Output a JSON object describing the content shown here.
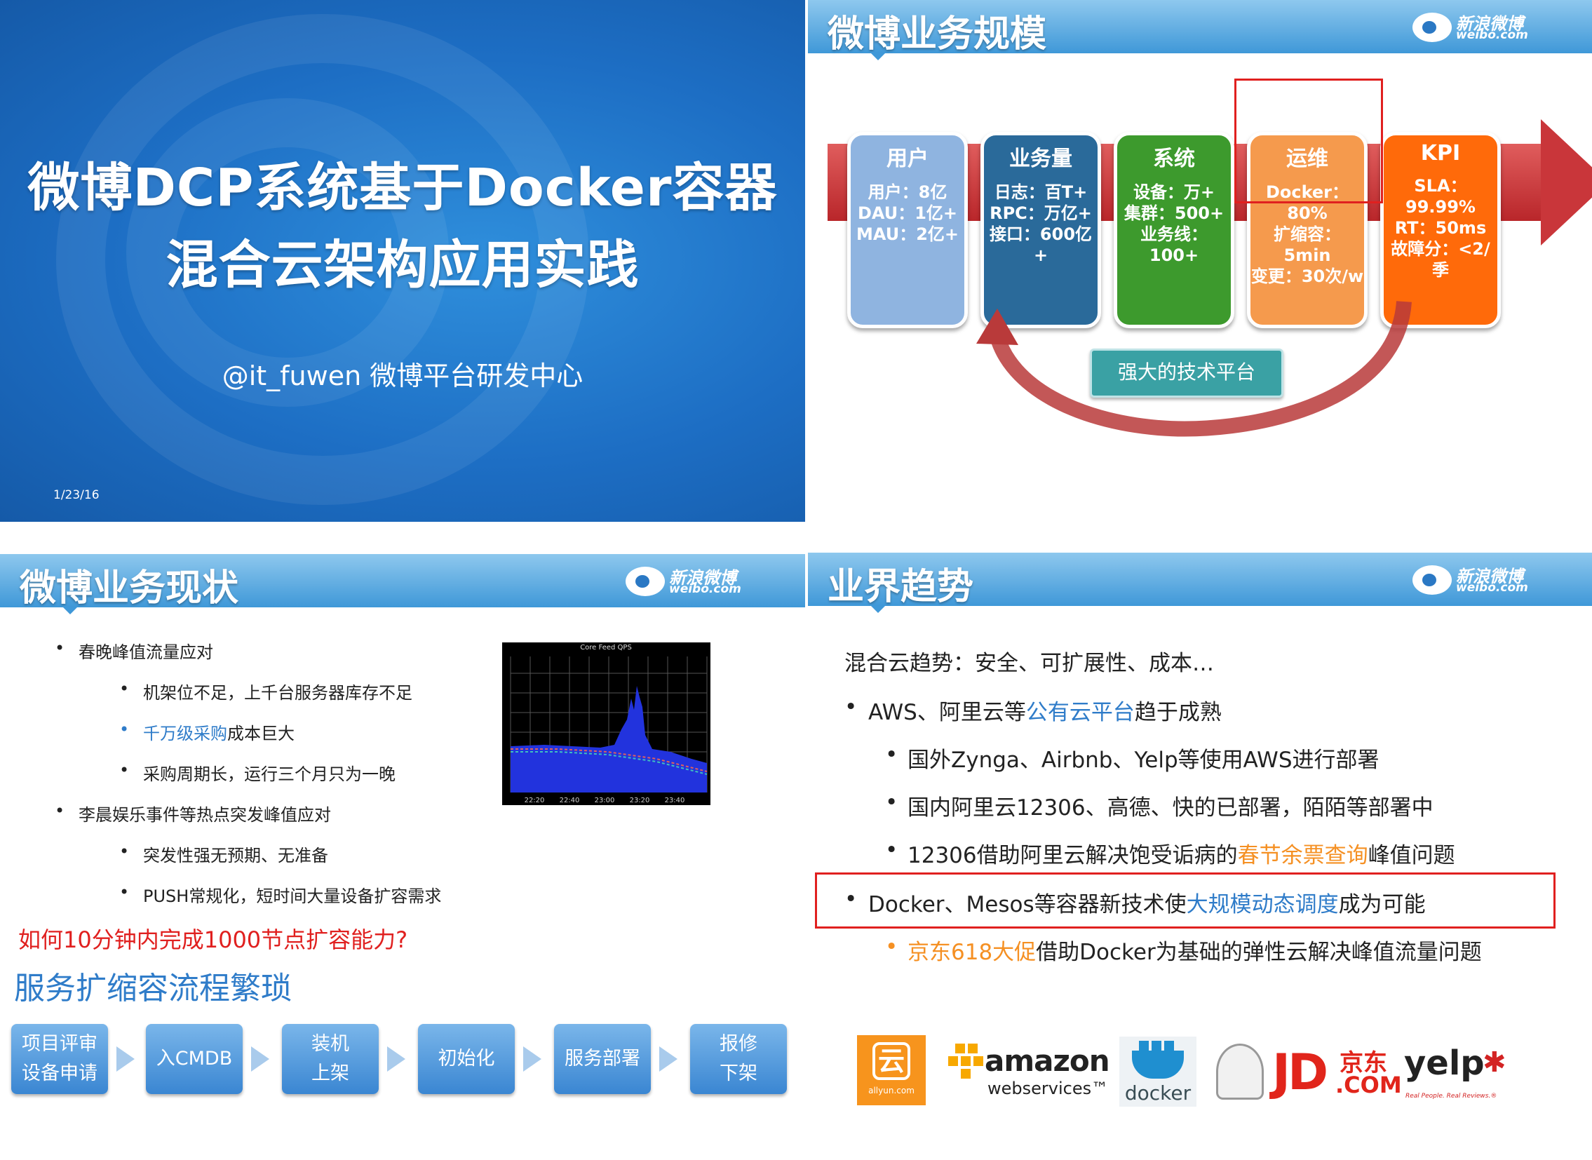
{
  "slide1": {
    "title_line1": "微博DCP系统基于Docker容器",
    "title_line2": "混合云架构应用实践",
    "subtitle": "@it_fuwen 微博平台研发中心",
    "date": "1/23/16"
  },
  "slide2": {
    "title": "微博业务规模",
    "logo_cn": "新浪微博",
    "logo_en": "weibo.com",
    "boxes": [
      {
        "header": "用户",
        "lines": [
          "用户：8亿",
          "DAU：1亿+",
          "MAU：2亿+"
        ],
        "color": "#8fb4e0"
      },
      {
        "header": "业务量",
        "lines": [
          "日志：百T+",
          "RPC：万亿+",
          "接口：600亿",
          "+"
        ],
        "color": "#2a6a9a"
      },
      {
        "header": "系统",
        "lines": [
          "设备：万+",
          "集群：500+",
          "业务线：100+"
        ],
        "color": "#3d9a2d"
      },
      {
        "header": "运维",
        "lines": [
          "Docker：80%",
          "扩缩容：5min",
          "变更：30次/w"
        ],
        "color": "#f59a4d"
      },
      {
        "header": "KPI",
        "lines": [
          "SLA：99.99%",
          "RT：50ms",
          "故障分：<2/季"
        ],
        "color": "#ff6a0a"
      }
    ],
    "platform_label": "强大的技术平台"
  },
  "slide3": {
    "title": "微博业务现状",
    "logo_cn": "新浪微博",
    "logo_en": "weibo.com",
    "bullets": [
      {
        "text": "春晚峰值流量应对",
        "level": 1
      },
      {
        "text": "机架位不足，上千台服务器库存不足",
        "level": 2
      },
      {
        "text_blue": "千万级采购",
        "text_rest": "成本巨大",
        "level": 2
      },
      {
        "text": "采购周期长，运行三个月只为一晚",
        "level": 2
      },
      {
        "text": "李晨娱乐事件等热点突发峰值应对",
        "level": 1
      },
      {
        "text": "突发性强无预期、无准备",
        "level": 2
      },
      {
        "text": "PUSH常规化，短时间大量设备扩容需求",
        "level": 2
      }
    ],
    "chart": {
      "title": "Core Feed QPS",
      "ticks": [
        "22:20",
        "22:40",
        "23:00",
        "23:20",
        "23:40"
      ]
    },
    "question": "如何10分钟内完成1000节点扩容能力?",
    "heading": "服务扩缩容流程繁琐",
    "steps": [
      {
        "line1": "项目评审",
        "line2": "设备申请"
      },
      {
        "line1": "入CMDB",
        "line2": ""
      },
      {
        "line1": "装机",
        "line2": "上架"
      },
      {
        "line1": "初始化",
        "line2": ""
      },
      {
        "line1": "服务部署",
        "line2": ""
      },
      {
        "line1": "报修",
        "line2": "下架"
      }
    ]
  },
  "slide4": {
    "title": "业界趋势",
    "logo_cn": "新浪微博",
    "logo_en": "weibo.com",
    "intro": "混合云趋势：安全、可扩展性、成本…",
    "b1_a": "AWS、阿里云等",
    "b1_blue": "公有云平台",
    "b1_b": "趋于成熟",
    "s1": "国外Zynga、Airbnb、Yelp等使用AWS进行部署",
    "s2": "国内阿里云12306、高德、快的已部署，陌陌等部署中",
    "s3_a": "12306借助阿里云解决饱受诟病的",
    "s3_orange": "春节余票查询",
    "s3_b": "峰值问题",
    "b2_a": "Docker、Mesos等容器新技术使",
    "b2_blue": "大规模动态调度",
    "b2_b": "成为可能",
    "s4_orange": "京东618大促",
    "s4_b": "借助Docker为基础的弹性云解决峰值流量问题",
    "logos": {
      "allyun": "allyun.com",
      "amazon": "amazon",
      "aws": "webservices™",
      "docker": "docker",
      "jd": "JD",
      "jd_cn": "京东",
      "jd_com": ".COM",
      "yelp": "yelp",
      "yelp_tag": "Real People. Real Reviews.®"
    }
  }
}
